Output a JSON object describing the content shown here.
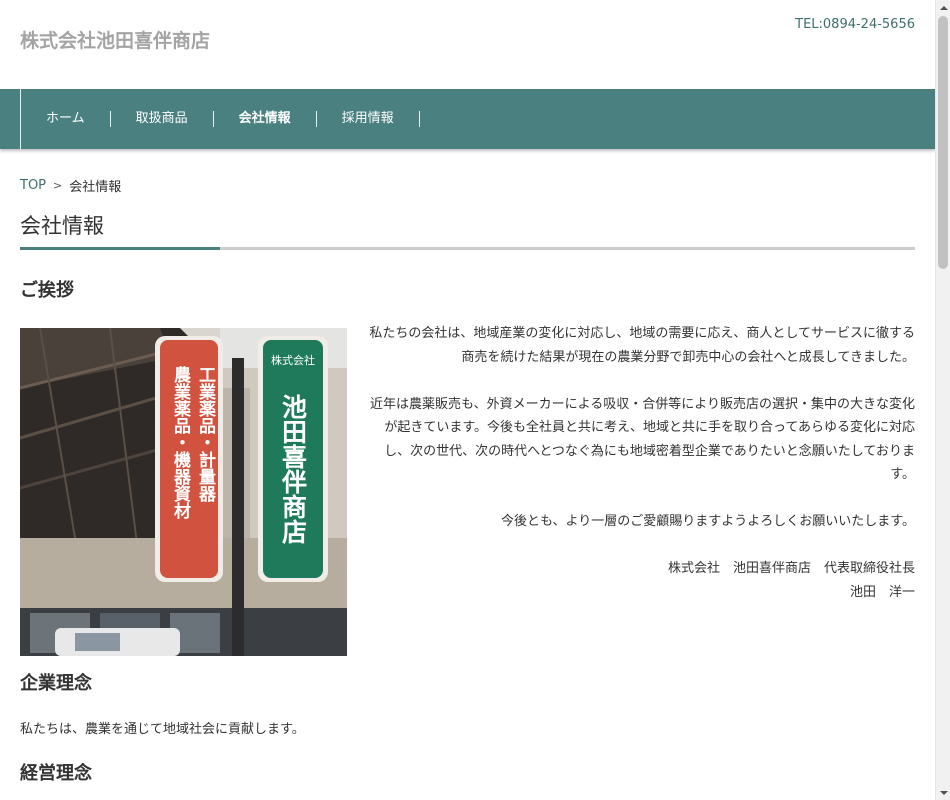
{
  "header": {
    "site_title": "株式会社池田喜伴商店",
    "tel": "TEL:0894-24-5656"
  },
  "nav": {
    "items": [
      {
        "label": "ホーム"
      },
      {
        "label": "取扱商品"
      },
      {
        "label": "会社情報"
      },
      {
        "label": "採用情報"
      }
    ],
    "active": "会社情報"
  },
  "breadcrumb": {
    "home": "TOP",
    "separator": ">",
    "current": "会社情報"
  },
  "page_title": "会社情報",
  "greeting_section": {
    "title": "ご挨拶",
    "paragraphs": [
      "私たちの会社は、地域産業の変化に対応し、地域の需要に応え、商人としてサービスに徹する商売を続けた結果が現在の農業分野で卸売中心の会社へと成長してきました。",
      "近年は農薬販売も、外資メーカーによる吸収・合併等により販売店の選択・集中の大きな変化が起きています。今後も全社員と共に考え、地域と共に手を取り合ってあらゆる変化に対応し、次の世代、次の時代へとつなぐ為にも地域密着型企業でありたいと念願いたしております。",
      "今後とも、より一層のご愛顧賜りますようよろしくお願いいたします。"
    ],
    "signature_company": "株式会社　池田喜伴商店　代表取締役社長　",
    "signature_name": "池田　洋一"
  },
  "photo": {
    "sign_left_col1": "工業薬品・計量器",
    "sign_left_col2": "農業薬品・機器資材",
    "sign_right_small": "株式会社",
    "sign_right_main": "池田喜伴商店"
  },
  "philosophy": {
    "title": "企業理念",
    "text": "私たちは、農業を通じて地域社会に貢献します。"
  },
  "management": {
    "title": "経営理念"
  },
  "colors": {
    "accent": "#4a8080",
    "nav_bg": "#4a8080",
    "tel_text": "#3f6e6e",
    "site_title": "#a4a4a4",
    "sign_red": "#d0523f",
    "sign_green": "#1f7a5c"
  }
}
